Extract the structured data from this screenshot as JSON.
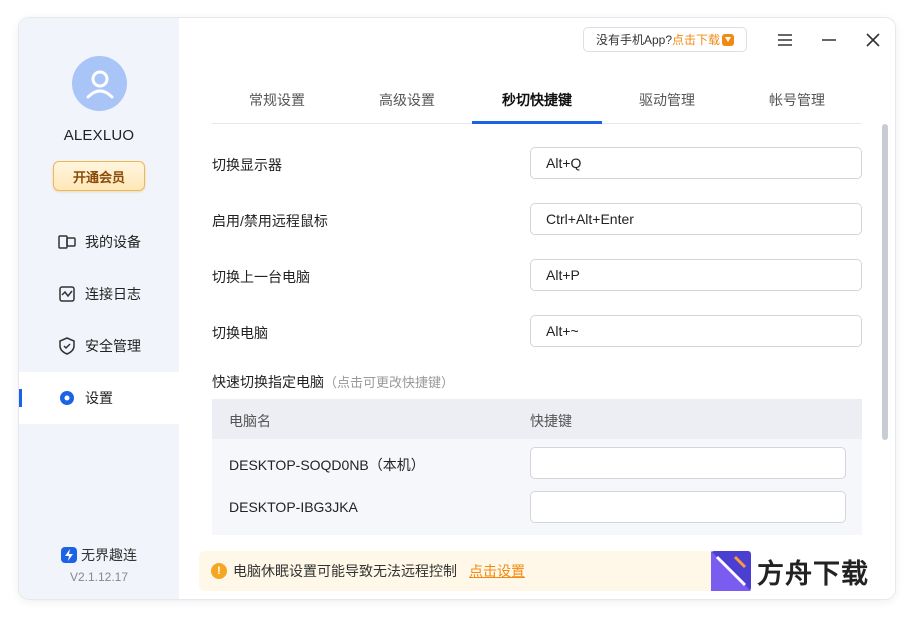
{
  "sidebar": {
    "username": "ALEXLUO",
    "vip_label": "开通会员",
    "nav": [
      {
        "label": "我的设备",
        "icon": "devices-icon"
      },
      {
        "label": "连接日志",
        "icon": "log-icon"
      },
      {
        "label": "安全管理",
        "icon": "shield-icon"
      },
      {
        "label": "设置",
        "icon": "settings-dot-icon"
      }
    ],
    "active_index": 3,
    "brand": "无界趣连",
    "version": "V2.1.12.17"
  },
  "header": {
    "promo_text": "没有手机App?",
    "promo_link": "点击下载"
  },
  "tabs": [
    "常规设置",
    "高级设置",
    "秒切快捷键",
    "驱动管理",
    "帐号管理"
  ],
  "active_tab": 2,
  "hotkeys": [
    {
      "label": "切换显示器",
      "value": "Alt+Q"
    },
    {
      "label": "启用/禁用远程鼠标",
      "value": "Ctrl+Alt+Enter"
    },
    {
      "label": "切换上一台电脑",
      "value": "Alt+P"
    },
    {
      "label": "切换电脑",
      "value": "Alt+~"
    }
  ],
  "quick_switch": {
    "title": "快速切换指定电脑",
    "hint": "（点击可更改快捷键）",
    "columns": [
      "电脑名",
      "快捷键"
    ],
    "rows": [
      {
        "name": "DESKTOP-SOQD0NB（本机）",
        "hotkey": ""
      },
      {
        "name": "DESKTOP-IBG3JKA",
        "hotkey": ""
      }
    ]
  },
  "warning": {
    "text": "电脑休眠设置可能导致无法远程控制",
    "link": "点击设置"
  },
  "watermark": "方舟下载",
  "colors": {
    "accent": "#1b63e6",
    "warning": "#f08a13",
    "sidebar_bg": "#f1f4fa"
  }
}
